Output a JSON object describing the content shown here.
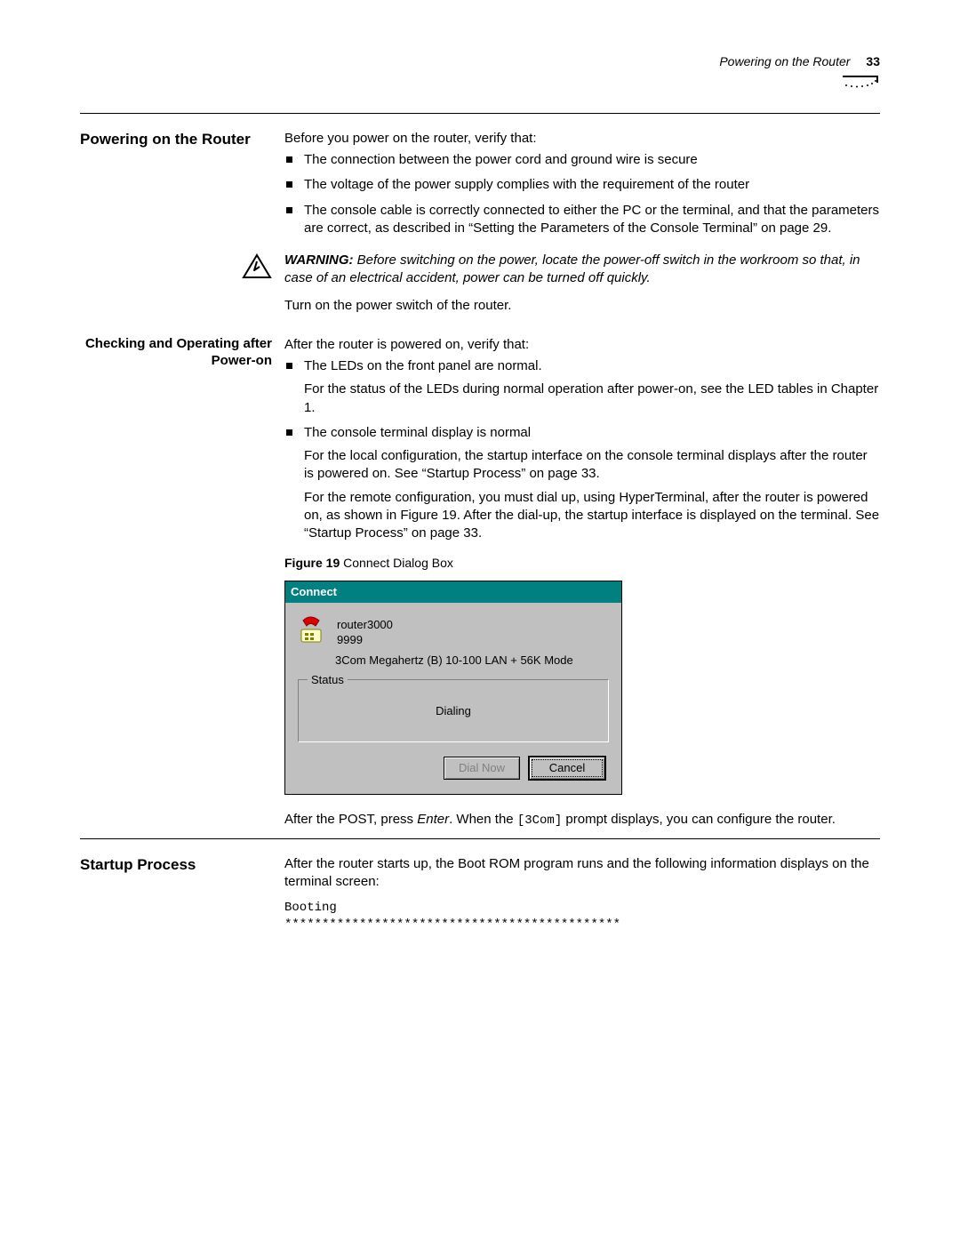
{
  "header": {
    "title": "Powering on the Router",
    "page": "33"
  },
  "s1": {
    "heading": "Powering on the Router",
    "intro": "Before you power on the router, verify that:",
    "bullets": [
      "The connection between the power cord and ground wire is secure",
      "The voltage of the power supply complies with the requirement of the router",
      "The console cable is correctly connected to either the PC or the terminal, and that the parameters are correct, as described in “Setting the Parameters of the Console Terminal” on page 29."
    ],
    "warning_label": "WARNING:",
    "warning_text": " Before switching on the power, locate the power-off switch in the workroom so that, in case of an electrical accident, power can be turned off quickly.",
    "turn_on": "Turn on the power switch of the router."
  },
  "s2": {
    "heading": "Checking and Operating after Power-on",
    "intro": "After the router is powered on, verify that:",
    "b1": "The LEDs on the front panel are normal.",
    "b1p": "For the status of the LEDs during normal operation after power-on, see the LED tables in Chapter 1.",
    "b2": "The console terminal display is normal",
    "b2p1": "For the local configuration, the startup interface on the console terminal displays after the router is powered on. See “Startup Process” on page 33.",
    "b2p2": "For the remote configuration, you must dial up, using HyperTerminal, after the router is powered on, as shown in Figure 19. After the dial-up, the startup interface is displayed on the terminal. See “Startup Process” on page 33."
  },
  "figure": {
    "label": "Figure 19",
    "caption": "   Connect Dialog Box"
  },
  "dialog": {
    "title": "Connect",
    "name": "router3000",
    "number": "9999",
    "modem": "3Com Megahertz (B) 10-100 LAN + 56K Mode",
    "status_label": "Status",
    "status_text": "Dialing",
    "btn_dial": "Dial Now",
    "btn_cancel": "Cancel"
  },
  "post": {
    "p1a": "After the POST, press ",
    "p1b": "Enter",
    "p1c": ". When the ",
    "p1d": "[3Com]",
    "p1e": " prompt displays, you can configure the router."
  },
  "s3": {
    "heading": "Startup Process",
    "p": "After the router starts up, the Boot ROM program runs and the following information displays on the terminal screen:",
    "code1": "Booting",
    "code2": "*********************************************"
  }
}
